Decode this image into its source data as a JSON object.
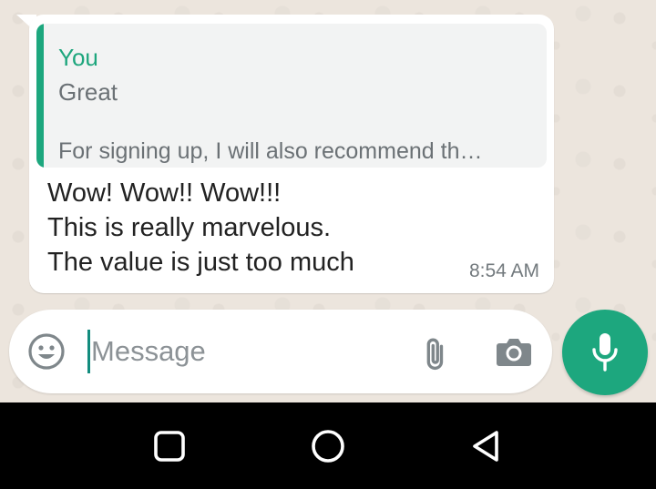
{
  "message": {
    "quote": {
      "author": "You",
      "line1": "Great",
      "line2": "For signing up, I will also recommend th…"
    },
    "lines": [
      "Wow! Wow!! Wow!!!",
      "This is really marvelous.",
      "The value is just too much"
    ],
    "time": "8:54 AM"
  },
  "composer": {
    "placeholder": "Message",
    "icons": [
      "emoji-icon",
      "attach-icon",
      "camera-icon",
      "mic-icon"
    ]
  },
  "nav": {
    "icons": [
      "recents-icon",
      "home-icon",
      "back-icon"
    ]
  },
  "colors": {
    "accent": "#1da77e",
    "chat_background": "#ece5dd",
    "bubble": "#ffffff",
    "quote_background": "#f2f3f3",
    "nav_background": "#000000"
  }
}
